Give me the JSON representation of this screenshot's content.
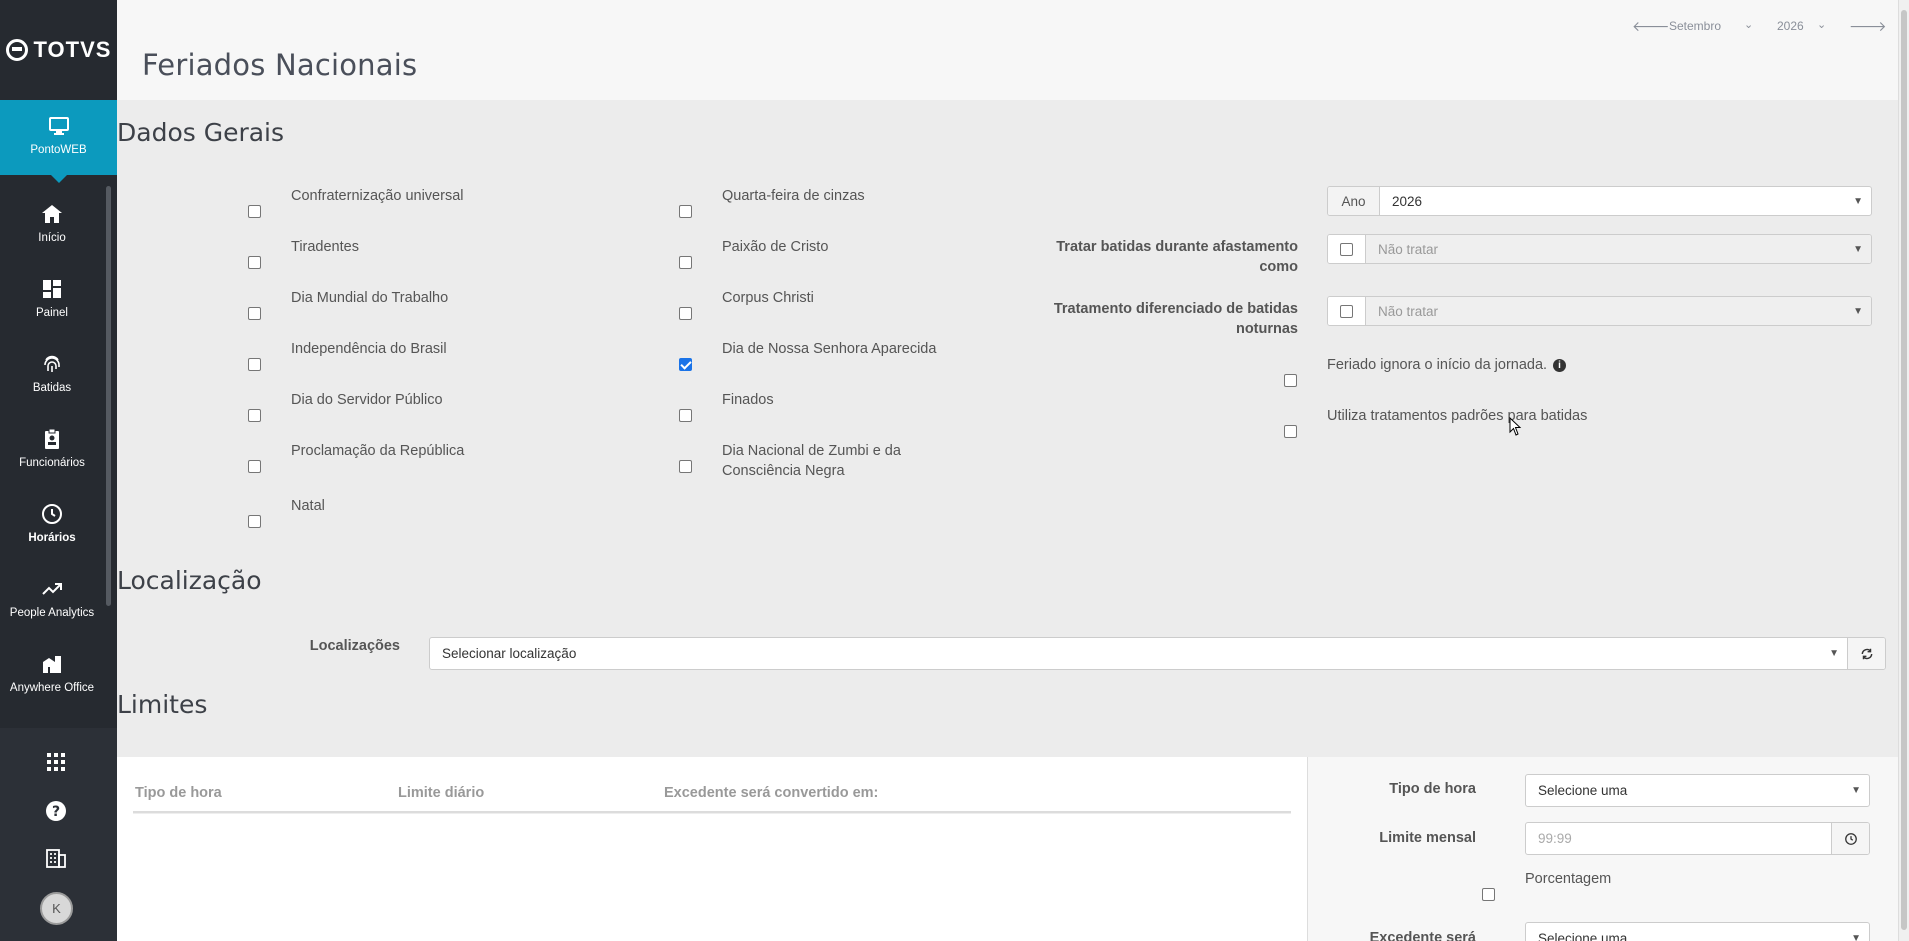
{
  "brand": {
    "name": "TOTVS"
  },
  "sidebar": {
    "active": {
      "label": "PontoWEB",
      "icon": "monitor-icon"
    },
    "items": [
      {
        "label": "Início",
        "icon": "home-icon"
      },
      {
        "label": "Painel",
        "icon": "dashboard-icon"
      },
      {
        "label": "Batidas",
        "icon": "fingerprint-icon"
      },
      {
        "label": "Funcionários",
        "icon": "badge-icon"
      },
      {
        "label": "Horários",
        "icon": "clock-icon"
      },
      {
        "label": "People Analytics",
        "icon": "trending-icon"
      },
      {
        "label": "Anywhere Office",
        "icon": "building-icon"
      }
    ],
    "bottom": [
      "apps-grid-icon",
      "help-icon",
      "company-icon"
    ],
    "avatar": "K"
  },
  "header": {
    "title": "Feriados Nacionais",
    "month": "Setembro",
    "year": "2026"
  },
  "sections": {
    "general": "Dados Gerais",
    "location": "Localização",
    "limits": "Limites"
  },
  "holidays_col1": [
    {
      "label": "Confraternização universal",
      "checked": false
    },
    {
      "label": "Tiradentes",
      "checked": false
    },
    {
      "label": "Dia Mundial do Trabalho",
      "checked": false
    },
    {
      "label": "Independência do Brasil",
      "checked": false
    },
    {
      "label": "Dia do Servidor Público",
      "checked": false
    },
    {
      "label": "Proclamação da República",
      "checked": false
    },
    {
      "label": "Natal",
      "checked": false
    }
  ],
  "holidays_col2": [
    {
      "label": "Quarta-feira de cinzas",
      "checked": false
    },
    {
      "label": "Paixão de Cristo",
      "checked": false
    },
    {
      "label": "Corpus Christi",
      "checked": false
    },
    {
      "label": "Dia de Nossa Senhora Aparecida",
      "checked": true
    },
    {
      "label": "Finados",
      "checked": false
    },
    {
      "label": "Dia Nacional de Zumbi e da Consciência Negra",
      "checked": false
    }
  ],
  "general_form": {
    "year_addon": "Ano",
    "year_value": "2026",
    "absence_label": "Tratar batidas durante afastamento como",
    "absence_value": "Não tratar",
    "night_label": "Tratamento diferenciado de batidas noturnas",
    "night_value": "Não tratar",
    "ignore_start_label": "Feriado ignora o início da jornada.",
    "default_treatment_label": "Utiliza tratamentos padrões para batidas"
  },
  "location_form": {
    "label": "Localizações",
    "placeholder": "Selecionar localização"
  },
  "limits_table": {
    "columns": [
      "Tipo de hora",
      "Limite diário",
      "Excedente será convertido em:"
    ]
  },
  "limits_form": {
    "hour_type_label": "Tipo de hora",
    "hour_type_value": "Selecione uma",
    "monthly_limit_label": "Limite mensal",
    "monthly_limit_placeholder": "99:99",
    "percentage_label": "Porcentagem",
    "excess_label": "Excedente será",
    "excess_value": "Selecione uma"
  }
}
